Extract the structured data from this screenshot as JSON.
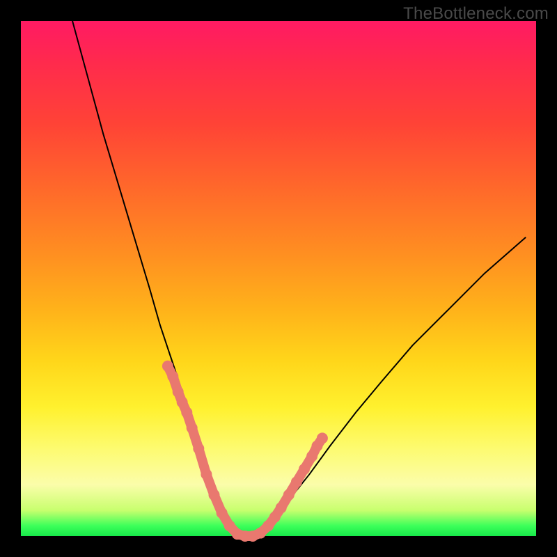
{
  "watermark": "TheBottleneck.com",
  "chart_data": {
    "type": "line",
    "title": "",
    "xlabel": "",
    "ylabel": "",
    "xlim": [
      0,
      100
    ],
    "ylim": [
      0,
      100
    ],
    "grid": false,
    "legend": false,
    "annotations": [],
    "series": [
      {
        "name": "bottleneck-curve",
        "x": [
          10,
          13,
          16,
          19,
          22,
          25,
          27,
          29,
          31,
          33,
          35,
          37,
          38.5,
          40,
          41.5,
          43,
          45,
          48,
          52,
          56,
          60,
          65,
          70,
          76,
          83,
          90,
          98
        ],
        "y": [
          100,
          89,
          78,
          68,
          58,
          48,
          41,
          35,
          29,
          23,
          17,
          11,
          7,
          3,
          1,
          0,
          0.5,
          2.5,
          7,
          12,
          17.5,
          24,
          30,
          37,
          44,
          51,
          58
        ]
      }
    ],
    "markers": {
      "comment": "salmon sample dots/segments along the lower portion of the curve",
      "points_x": [
        28.5,
        29.5,
        30.5,
        31.3,
        32.2,
        33.2,
        34.5,
        36.0,
        37.5,
        39.0,
        40.5,
        42.0,
        43.5,
        45.0,
        46.5,
        48.0,
        49.3,
        50.5,
        52.0,
        53.5,
        55.0,
        56.5,
        57.5,
        58.5
      ],
      "points_y": [
        33,
        31,
        28,
        26,
        24,
        21,
        17,
        12,
        8,
        4.5,
        2,
        0.4,
        0,
        0,
        0.6,
        2,
        3.7,
        5.5,
        8,
        10.5,
        13,
        15.5,
        17.5,
        19
      ]
    }
  }
}
